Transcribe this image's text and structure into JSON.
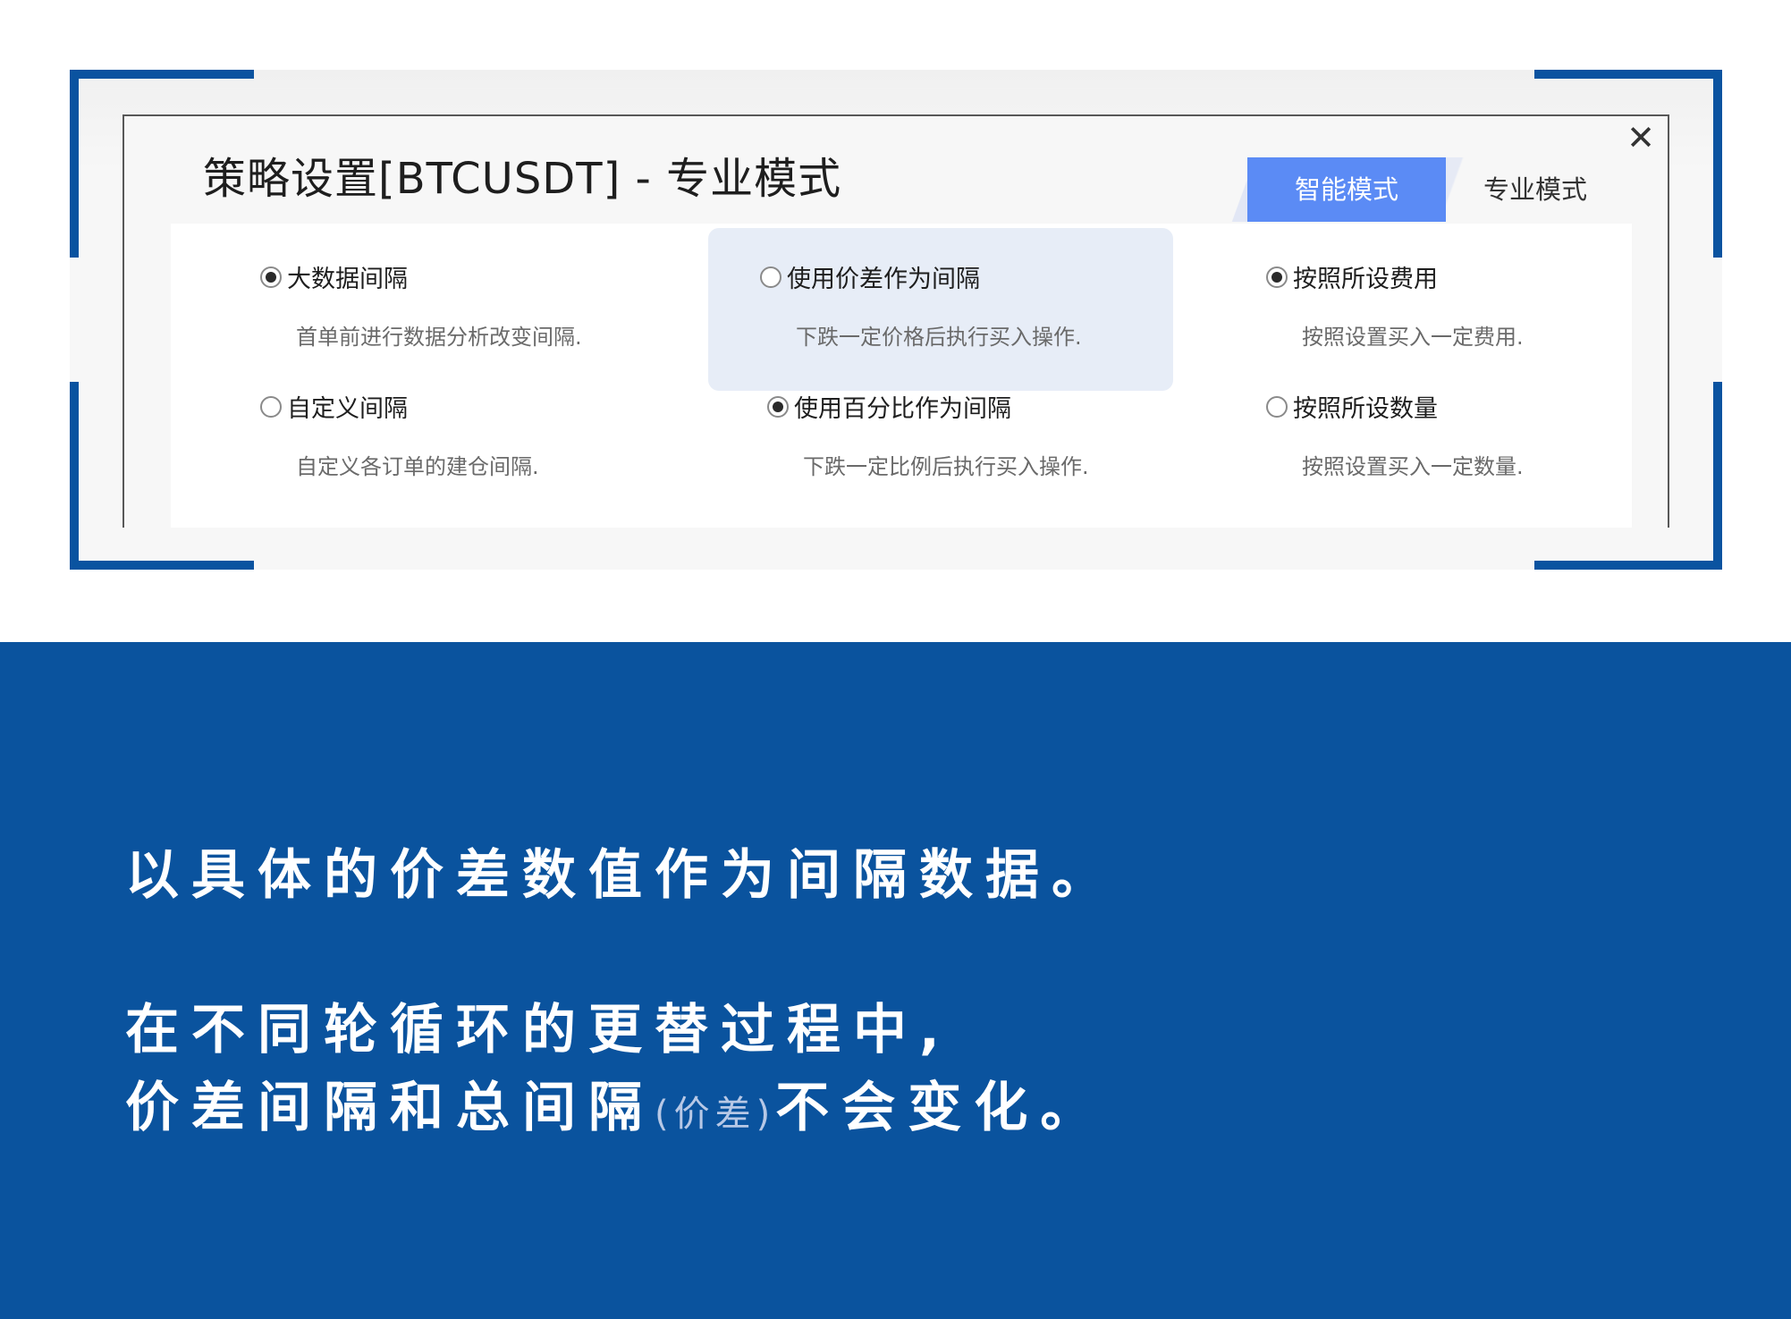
{
  "dialog": {
    "title": "策略设置[BTCUSDT] - 专业模式",
    "close_symbol": "✕",
    "tabs": [
      {
        "label": "智能模式",
        "active": true
      },
      {
        "label": "专业模式",
        "active": false
      }
    ],
    "options": [
      {
        "label": "大数据间隔",
        "desc": "首单前进行数据分析改变间隔.",
        "checked": true
      },
      {
        "label": "使用价差作为间隔",
        "desc": "下跌一定价格后执行买入操作.",
        "checked": false,
        "highlighted": true
      },
      {
        "label": "按照所设费用",
        "desc": "按照设置买入一定费用.",
        "checked": true
      },
      {
        "label": "自定义间隔",
        "desc": "自定义各订单的建仓间隔.",
        "checked": false
      },
      {
        "label": "使用百分比作为间隔",
        "desc": "下跌一定比例后执行买入操作.",
        "checked": true
      },
      {
        "label": "按照所设数量",
        "desc": "按照设置买入一定数量.",
        "checked": false
      }
    ]
  },
  "caption": {
    "line1": "以具体的价差数值作为间隔数据。",
    "line2": "在不同轮循环的更替过程中,",
    "line3_main": "价差间隔和总间隔",
    "line3_aside": "(价差)",
    "line3_end": "不会变化。"
  },
  "colors": {
    "brand_blue": "#0a539e",
    "smart_tab": "#5b8bf5",
    "highlight": "#e7edf7"
  }
}
